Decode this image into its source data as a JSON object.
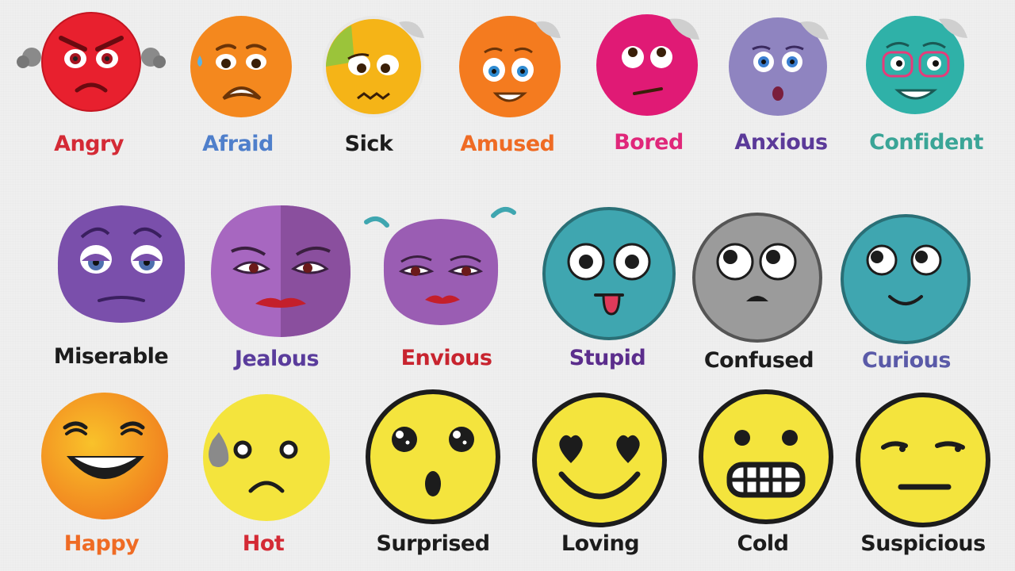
{
  "emotions": [
    {
      "label": "Angry",
      "color": "#d42a35",
      "face": "#e8202e",
      "icon": "angry-face-icon"
    },
    {
      "label": "Afraid",
      "color": "#4f7fcb",
      "face": "#f4881e",
      "icon": "afraid-face-icon"
    },
    {
      "label": "Sick",
      "color": "#1c1c1c",
      "face": "#f5b417",
      "icon": "sick-face-icon"
    },
    {
      "label": "Amused",
      "color": "#ef6b24",
      "face": "#f47b1f",
      "icon": "amused-face-icon"
    },
    {
      "label": "Bored",
      "color": "#e0277a",
      "face": "#e01a75",
      "icon": "bored-face-icon"
    },
    {
      "label": "Anxious",
      "color": "#5b3a99",
      "face": "#8f84c0",
      "icon": "anxious-face-icon"
    },
    {
      "label": "Confident",
      "color": "#3aa597",
      "face": "#2fb1a8",
      "icon": "confident-face-icon"
    },
    {
      "label": "Miserable",
      "color": "#1c1c1c",
      "face": "#7a4fab",
      "icon": "miserable-face-icon"
    },
    {
      "label": "Jealous",
      "color": "#5a3c9c",
      "face": "#9a5db3",
      "icon": "jealous-face-icon"
    },
    {
      "label": "Envious",
      "color": "#c8242f",
      "face": "#9a5db3",
      "icon": "envious-face-icon"
    },
    {
      "label": "Stupid",
      "color": "#5b2d8c",
      "face": "#3fa6b0",
      "icon": "stupid-face-icon"
    },
    {
      "label": "Confused",
      "color": "#1c1c1c",
      "face": "#9b9b9b",
      "icon": "confused-face-icon"
    },
    {
      "label": "Curious",
      "color": "#5a5aa8",
      "face": "#3fa6b0",
      "icon": "curious-face-icon"
    },
    {
      "label": "Happy",
      "color": "#ef6b24",
      "face": "#f7a21c",
      "icon": "happy-face-icon"
    },
    {
      "label": "Hot",
      "color": "#d42a35",
      "face": "#f4e43d",
      "icon": "hot-face-icon"
    },
    {
      "label": "Surprised",
      "color": "#1c1c1c",
      "face": "#f4e43d",
      "icon": "surprised-face-icon"
    },
    {
      "label": "Loving",
      "color": "#1c1c1c",
      "face": "#f4e43d",
      "icon": "loving-face-icon"
    },
    {
      "label": "Cold",
      "color": "#1c1c1c",
      "face": "#f4e43d",
      "icon": "cold-face-icon"
    },
    {
      "label": "Suspicious",
      "color": "#1c1c1c",
      "face": "#f4e43d",
      "icon": "suspicious-face-icon"
    }
  ]
}
